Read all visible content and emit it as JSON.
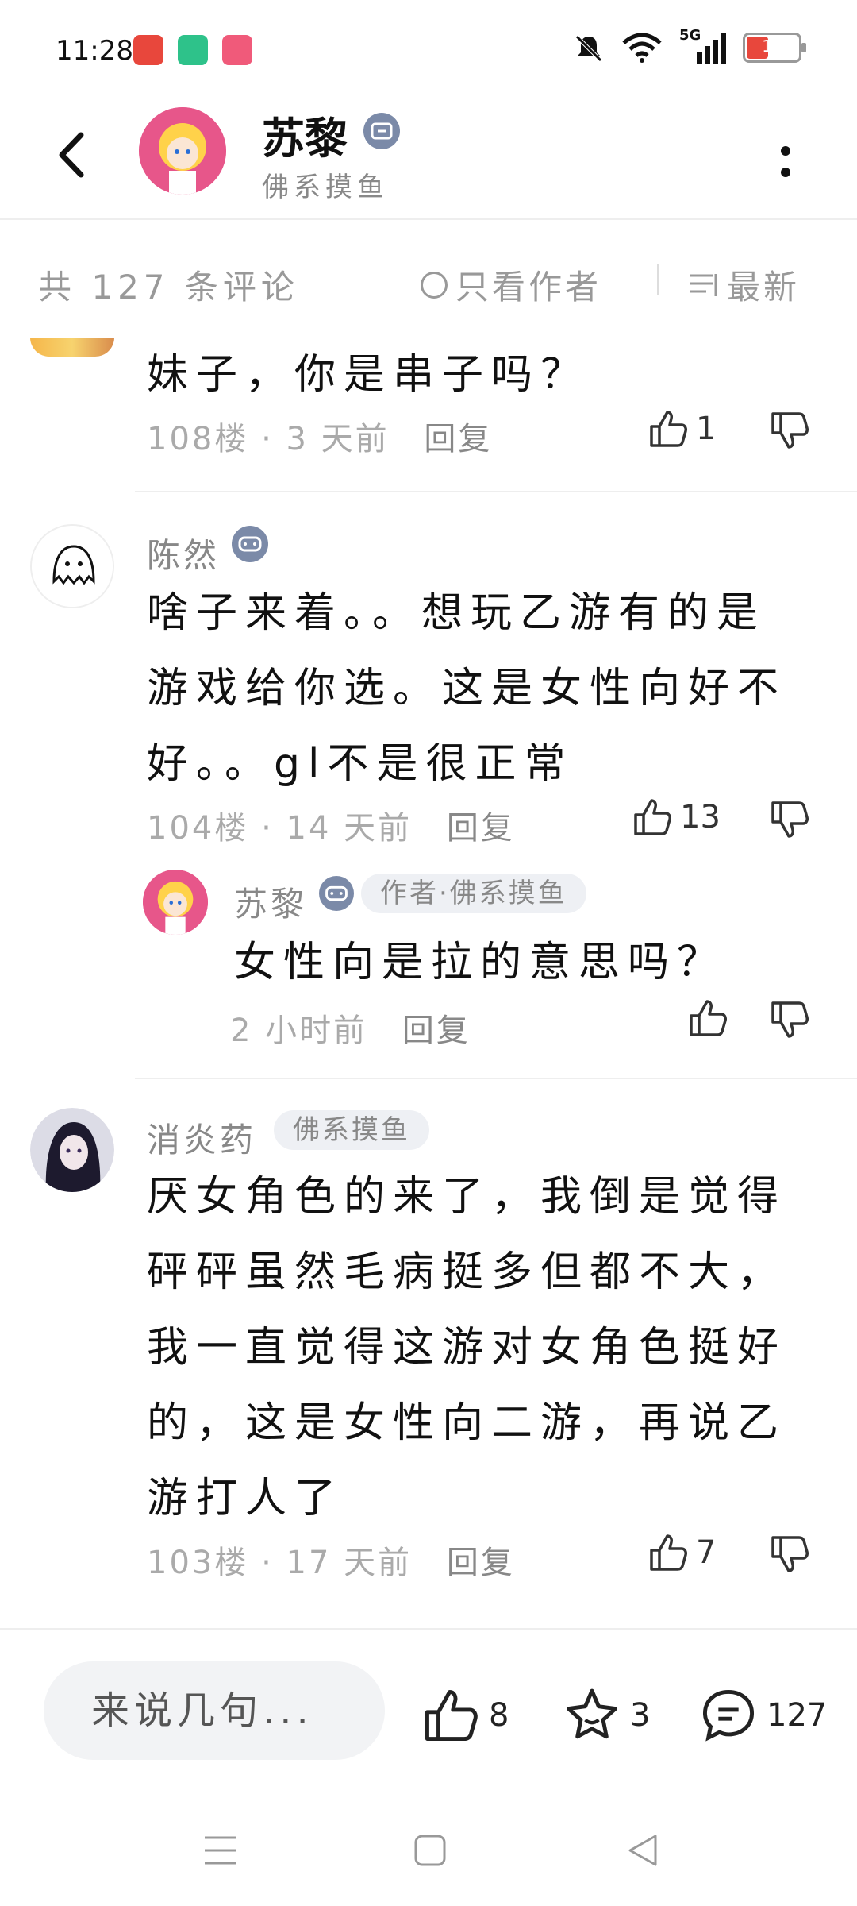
{
  "status_bar": {
    "time": "11:28",
    "network": "5G",
    "battery": "19"
  },
  "header": {
    "title": "苏黎",
    "subtitle": "佛系摸鱼"
  },
  "filter": {
    "count_label": "共 127 条评论",
    "only_author": "只看作者",
    "sort": "最新"
  },
  "comments": [
    {
      "text": "妹子，你是串子吗？",
      "floor": "108楼",
      "time": "3 天前",
      "reply": "回复",
      "likes": "1"
    },
    {
      "name": "陈然",
      "text_lines": [
        "啥子来着。。想玩乙游有的是",
        "游戏给你选。这是女性向好不",
        "好。。gl不是很正常"
      ],
      "floor": "104楼",
      "time": "14 天前",
      "reply": "回复",
      "likes": "13",
      "sub_reply": {
        "name": "苏黎",
        "chip": "作者·佛系摸鱼",
        "text": "女性向是拉的意思吗？",
        "time": "2 小时前",
        "reply": "回复"
      }
    },
    {
      "name": "消炎药",
      "chip": "佛系摸鱼",
      "text_lines": [
        "厌女角色的来了，我倒是觉得",
        "砰砰虽然毛病挺多但都不大，",
        "我一直觉得这游对女角色挺好",
        "的，这是女性向二游，再说乙",
        "游打人了"
      ],
      "floor": "103楼",
      "time": "17 天前",
      "reply": "回复",
      "likes": "7"
    }
  ],
  "bottom_bar": {
    "input_placeholder": "来说几句...",
    "likes": "8",
    "favorites": "3",
    "comments": "127"
  },
  "colors": {
    "avatar_pink": "#e7568a",
    "badge_blue": "#7b8aa8",
    "battery_red": "#e8473c"
  }
}
